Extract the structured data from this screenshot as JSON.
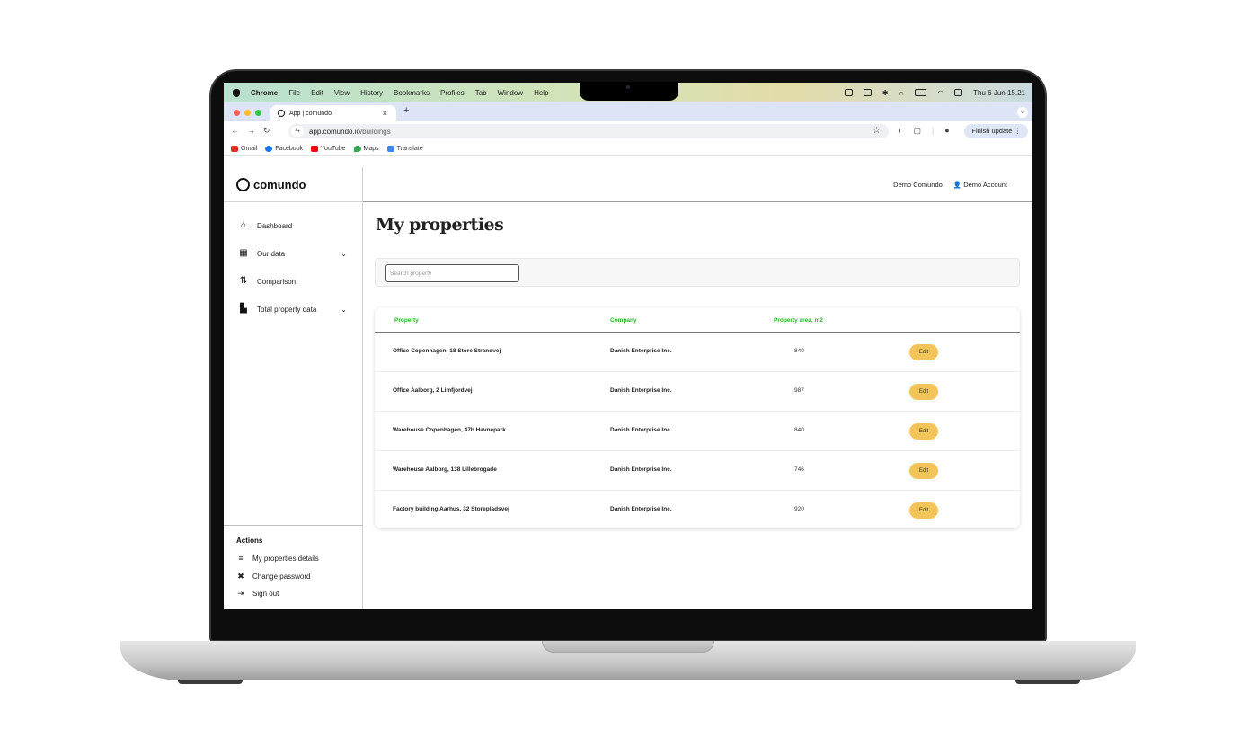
{
  "menubar": {
    "app_name": "Chrome",
    "items": [
      "File",
      "Edit",
      "View",
      "History",
      "Bookmarks",
      "Profiles",
      "Tab",
      "Window",
      "Help"
    ],
    "datetime": "Thu 6 Jun  15.21"
  },
  "browser": {
    "tab_title": "App | comundo",
    "tab_close": "×",
    "new_tab": "+",
    "url_host": "app.comundo.io",
    "url_path": "/buildings",
    "finish_update": "Finish update",
    "bookmarks": [
      {
        "label": "Gmail",
        "color": "#d93025"
      },
      {
        "label": "Facebook",
        "color": "#1877f2"
      },
      {
        "label": "YouTube",
        "color": "#ff0000"
      },
      {
        "label": "Maps",
        "color": "#34a853"
      },
      {
        "label": "Translate",
        "color": "#4285f4"
      }
    ]
  },
  "app": {
    "logo_text": "comundo",
    "header": {
      "org": "Demo Comundo",
      "account": "Demo Account"
    },
    "nav": [
      {
        "label": "Dashboard",
        "icon": "home-icon"
      },
      {
        "label": "Our data",
        "icon": "building-icon",
        "expandable": true
      },
      {
        "label": "Comparison",
        "icon": "compare-icon"
      },
      {
        "label": "Total property data",
        "icon": "buildings-icon",
        "expandable": true
      }
    ],
    "actions": {
      "title": "Actions",
      "items": [
        {
          "label": "My properties details",
          "icon": "edit-list-icon"
        },
        {
          "label": "Change password",
          "icon": "tools-icon"
        },
        {
          "label": "Sign out",
          "icon": "sign-out-icon"
        }
      ]
    },
    "page_title": "My properties",
    "search_placeholder": "Search property",
    "table": {
      "columns": [
        "Property",
        "Company",
        "Property area, m2"
      ],
      "edit_label": "Edit",
      "rows": [
        {
          "property": "Office Copenhagen, 18 Store Strandvej",
          "company": "Danish Enterprise Inc.",
          "area": "840"
        },
        {
          "property": "Office Aalborg, 2 Limfjordvej",
          "company": "Danish Enterprise Inc.",
          "area": "987"
        },
        {
          "property": "Warehouse Copenhagen, 47b Havnepark",
          "company": "Danish Enterprise Inc.",
          "area": "840"
        },
        {
          "property": "Warehouse Aalborg, 138 Lillebrogade",
          "company": "Danish Enterprise Inc.",
          "area": "746"
        },
        {
          "property": "Factory building Aarhus, 32 Storepladsvej",
          "company": "Danish Enterprise Inc.",
          "area": "920"
        }
      ]
    },
    "colors": {
      "accent_green": "#2db32d",
      "edit_button": "#f3c45a"
    }
  }
}
